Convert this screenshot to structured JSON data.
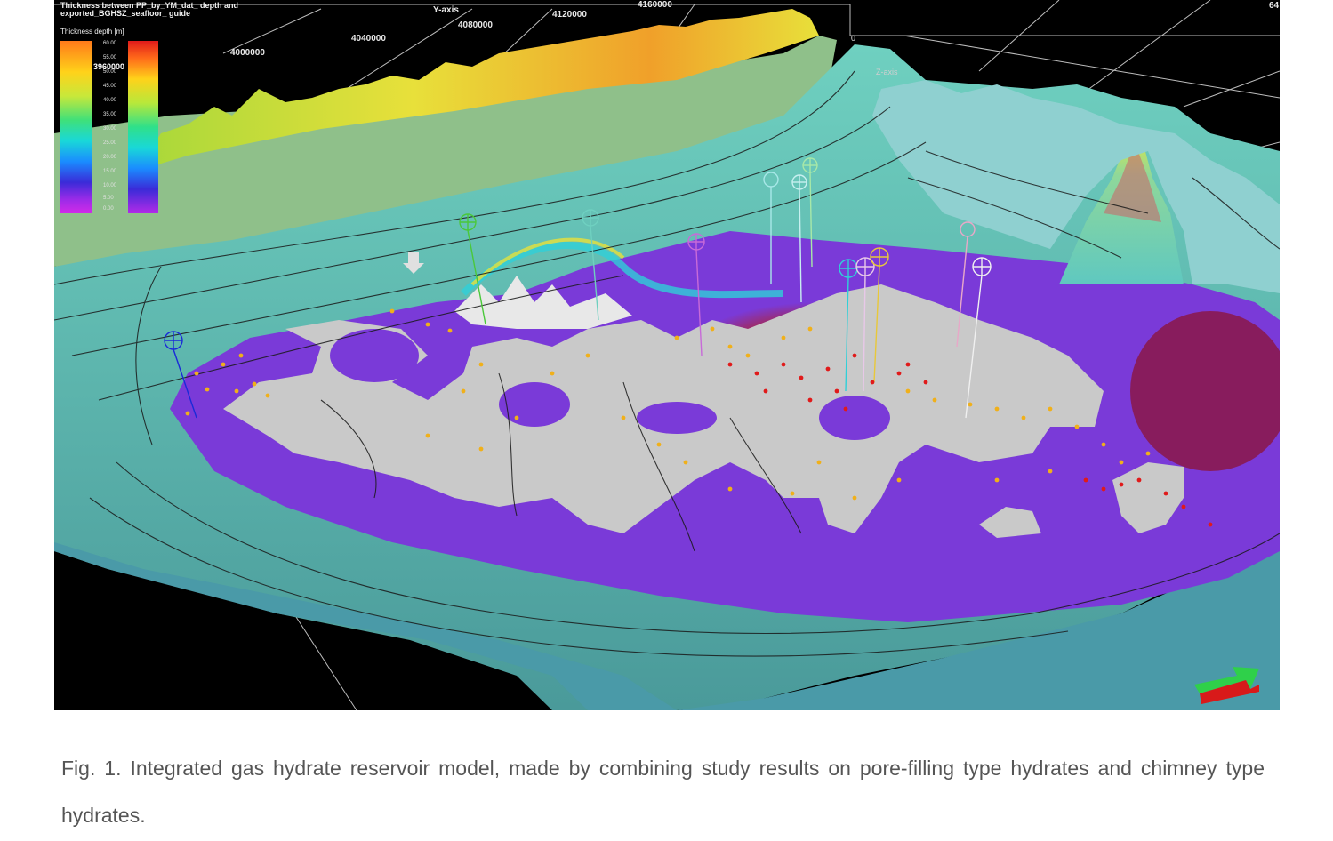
{
  "legend": {
    "title": "Thickness between PP_by_YM_dat_ depth and exported_BGHSZ_seafloor_ guide",
    "subtitle": "Thickness depth [m]",
    "ticks": [
      "60.00",
      "55.00",
      "50.00",
      "45.00",
      "40.00",
      "35.00",
      "30.00",
      "25.00",
      "20.00",
      "15.00",
      "10.00",
      "5.00",
      "0.00"
    ],
    "coord_overlay": "3960000"
  },
  "axes": {
    "y_axis_label": "Y-axis",
    "z_axis_label": "Z-axis",
    "y_ticks": [
      "4000000",
      "4040000",
      "4080000",
      "4120000",
      "4160000"
    ],
    "top_right_tick": "64",
    "z_zero": "0"
  },
  "caption": "Fig. 1. Integrated gas hydrate reservoir model, made by combining study results on pore-filling type hydrates and chimney type hydrates.",
  "colors": {
    "background": "#000000",
    "hydrate_zone": "#7a3ad8",
    "white_zone": "#c8c8c8",
    "slope": "#5fb8a8",
    "shelf": "#8fc08a",
    "ridge": "#e8d83a",
    "hot": "#a01a4a"
  }
}
